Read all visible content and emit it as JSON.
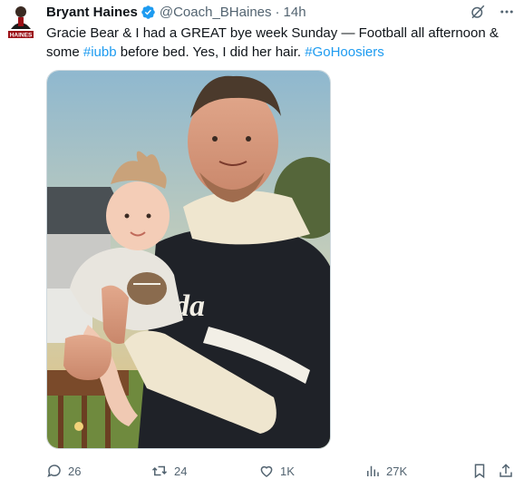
{
  "tweet": {
    "author_name": "Bryant Haines",
    "handle": "@Coach_BHaines",
    "separator": "·",
    "time": "14h",
    "avatar_text": "HAINES",
    "text_before_tag1": "Gracie Bear & I had a GREAT bye week Sunday — Football all afternoon & some ",
    "hashtag1": "#iubb",
    "text_between": " before bed.  Yes, I did her hair.  ",
    "hashtag2": "#GoHoosiers"
  },
  "photo": {
    "jersey_text": "da"
  },
  "actions": {
    "replies": "26",
    "reposts": "24",
    "likes": "1K",
    "views": "27K"
  },
  "icons": [
    "grok-icon",
    "more-icon",
    "reply-icon",
    "repost-icon",
    "like-icon",
    "views-icon",
    "bookmark-icon",
    "share-icon",
    "verified-badge-icon"
  ],
  "colors": {
    "accent": "#1d9bf0",
    "text": "#0f1419",
    "muted": "#536471"
  }
}
